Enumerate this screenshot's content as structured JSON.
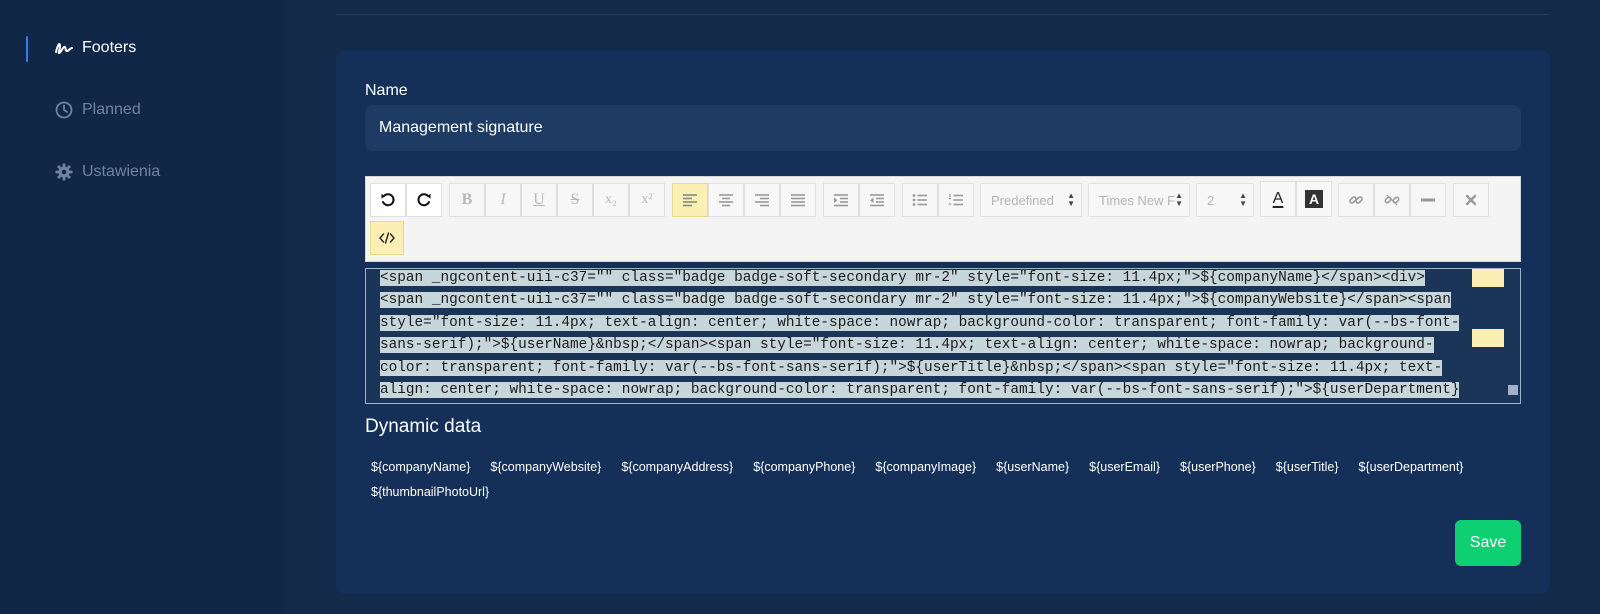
{
  "sidebar": {
    "items": [
      {
        "label": "Footers",
        "icon": "signature-icon",
        "active": true
      },
      {
        "label": "Planned",
        "icon": "clock-icon",
        "active": false
      },
      {
        "label": "Ustawienia",
        "icon": "gear-icon",
        "active": false
      }
    ]
  },
  "form": {
    "name_label": "Name",
    "name_value": "Management signature"
  },
  "toolbar": {
    "bold": "B",
    "italic": "I",
    "underline": "U",
    "strike": "S",
    "subscript": "x₂",
    "superscript": "x²",
    "font_size_select": "Predefined",
    "font_family_select": "Times New F",
    "line_height_select": "2",
    "text_color": "A",
    "bg_color": "A"
  },
  "code": {
    "lines": [
      "<span _ngcontent-uii-c37=\"\" class=\"badge badge-soft-secondary mr-2\" style=\"font-size: 11.4px;\">${companyName}</span><div>",
      "<span _ngcontent-uii-c37=\"\" class=\"badge badge-soft-secondary mr-2\" style=\"font-size: 11.4px;\">${companyWebsite}</span><span",
      "style=\"font-size: 11.4px; text-align: center; white-space: nowrap; background-color: transparent; font-family: var(--bs-font-",
      "sans-serif);\">${userName}&nbsp;</span><span style=\"font-size: 11.4px; text-align: center; white-space: nowrap; background-",
      "color: transparent; font-family: var(--bs-font-sans-serif);\">${userTitle}&nbsp;</span><span style=\"font-size: 11.4px; text-",
      "align: center; white-space: nowrap; background-color: transparent; font-family: var(--bs-font-sans-serif);\">${userDepartment}"
    ]
  },
  "dynamic": {
    "title": "Dynamic data",
    "items": [
      "${companyName}",
      "${companyWebsite}",
      "${companyAddress}",
      "${companyPhone}",
      "${companyImage}",
      "${userName}",
      "${userEmail}",
      "${userPhone}",
      "${userTitle}",
      "${userDepartment}",
      "${thumbnailPhotoUrl}"
    ]
  },
  "actions": {
    "save_label": "Save"
  },
  "colors": {
    "background": "#142a4a",
    "card": "#143058",
    "input": "#1d3b63",
    "accent": "#0fcf73",
    "active_nav": "#3b7ddd"
  }
}
